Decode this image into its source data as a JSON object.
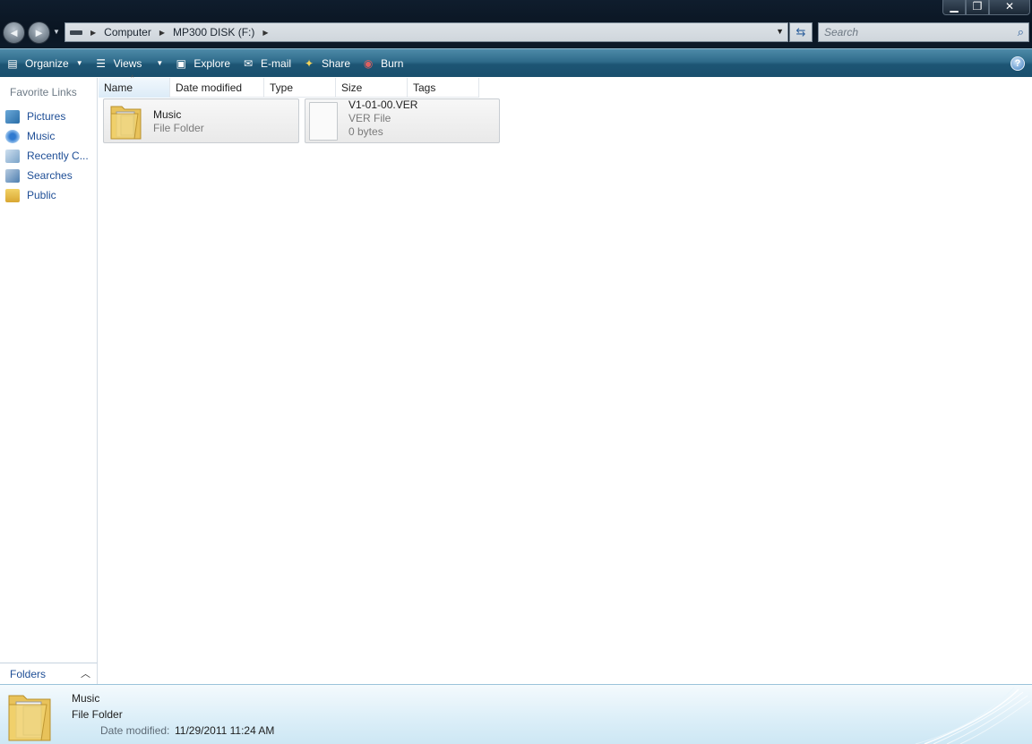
{
  "window": {
    "minimize": "▁",
    "maximize": "❐",
    "close": "✕"
  },
  "navigation": {
    "back_icon": "back-arrow",
    "forward_icon": "forward-arrow"
  },
  "address": {
    "crumbs": [
      "Computer",
      "MP300 DISK (F:)"
    ]
  },
  "search": {
    "placeholder": "Search"
  },
  "toolbar": {
    "organize": "Organize",
    "views": "Views",
    "explore": "Explore",
    "email": "E-mail",
    "share": "Share",
    "burn": "Burn",
    "help": "?"
  },
  "sidebar": {
    "heading": "Favorite Links",
    "items": [
      {
        "label": "Pictures",
        "icon": "pictures-icon"
      },
      {
        "label": "Music",
        "icon": "music-icon"
      },
      {
        "label": "Recently C...",
        "icon": "recent-icon"
      },
      {
        "label": "Searches",
        "icon": "searches-icon"
      },
      {
        "label": "Public",
        "icon": "public-folder-icon"
      }
    ],
    "folders_label": "Folders"
  },
  "columns": [
    "Name",
    "Date modified",
    "Type",
    "Size",
    "Tags"
  ],
  "files": [
    {
      "name": "Music",
      "line2": "File Folder",
      "line3": ""
    },
    {
      "name": "V1-01-00.VER",
      "line2": "VER File",
      "line3": "0 bytes"
    }
  ],
  "details": {
    "name": "Music",
    "type": "File Folder",
    "date_label": "Date modified:",
    "date_value": "11/29/2011 11:24 AM"
  },
  "colors": {
    "link": "#1e4e96",
    "toolbar": "#1d5574",
    "details_bg": "#dbeef8"
  }
}
